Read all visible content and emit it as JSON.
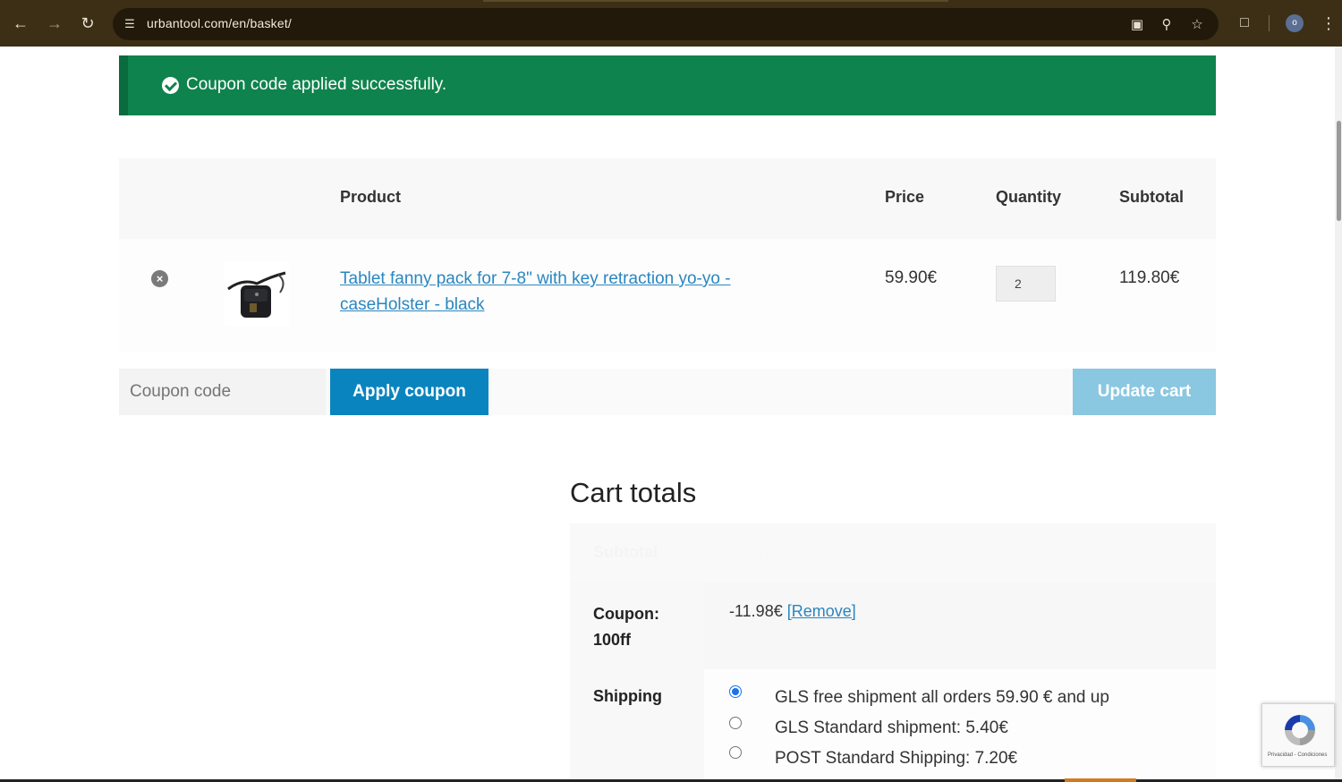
{
  "browser": {
    "url": "urbantool.com/en/basket/",
    "profile_initial": "o"
  },
  "notice": {
    "message": "Coupon code applied successfully."
  },
  "cart": {
    "headers": {
      "product": "Product",
      "price": "Price",
      "quantity": "Quantity",
      "subtotal": "Subtotal"
    },
    "items": [
      {
        "name": "Tablet fanny pack for 7-8\" with key retraction yo-yo - caseHolster - black",
        "price": "59.90€",
        "quantity": "2",
        "subtotal": "119.80€"
      }
    ],
    "coupon_placeholder": "Coupon code",
    "apply_label": "Apply coupon",
    "update_label": "Update cart"
  },
  "totals": {
    "title": "Cart totals",
    "subtotal_label": "Subtotal",
    "subtotal_value": "119.80€",
    "coupon_label": "Coupon: 100ff",
    "coupon_value": "-11.98€",
    "coupon_remove": "[Remove]",
    "shipping_label": "Shipping",
    "shipping_options": [
      "GLS free shipment all orders 59.90 € and up",
      "GLS Standard shipment: 5.40€",
      "POST Standard Shipping: 7.20€"
    ]
  },
  "recaptcha": {
    "footer": "Privacidad - Condiciones"
  },
  "colors": {
    "notice_bg": "#0f834d",
    "primary_button": "#0a84bf",
    "disabled_button": "#8ac7e1",
    "link": "#2a86c0"
  }
}
